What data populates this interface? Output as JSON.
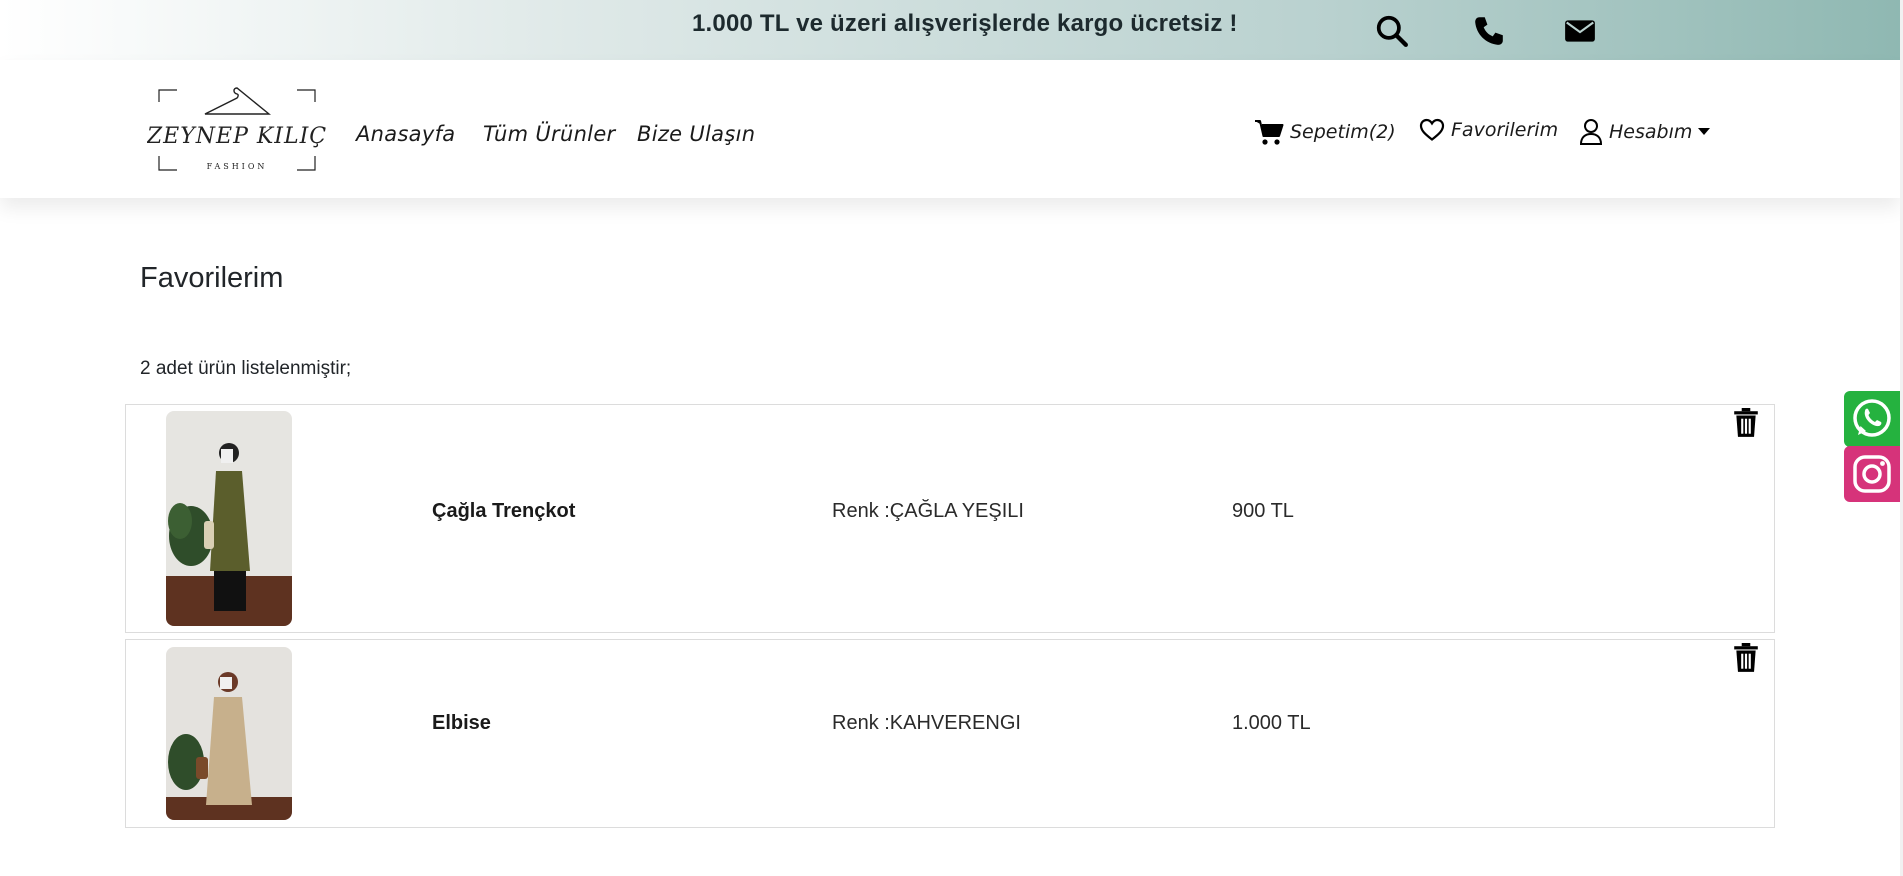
{
  "topbar": {
    "promo_text": "1.000 TL ve üzeri alışverişlerde kargo ücretsiz !",
    "icons": [
      "search-icon",
      "phone-icon",
      "envelope-icon"
    ]
  },
  "header": {
    "logo": {
      "brand": "ZEYNEP KILIÇ",
      "sub": "FASHION"
    },
    "nav": [
      "Anasayfa",
      "Tüm Ürünler",
      "Bize Ulaşın"
    ],
    "cart_label": "Sepetim(2)",
    "favorites_label": "Favorilerim",
    "account_label": "Hesabım"
  },
  "main": {
    "title": "Favorilerim",
    "count_text": "2 adet ürün listelenmiştir;",
    "items": [
      {
        "name": "Çağla Trençkot",
        "color": "Renk :ÇAĞLA YEŞILI",
        "price": "900 TL"
      },
      {
        "name": "Elbise",
        "color": "Renk :KAHVERENGI",
        "price": "1.000 TL"
      }
    ]
  },
  "social": {
    "icons": [
      "whatsapp-icon",
      "instagram-icon"
    ]
  },
  "colors": {
    "whatsapp": "#25b23f",
    "instagram": "#d6337a",
    "banner_end": "#8fb8b2"
  }
}
